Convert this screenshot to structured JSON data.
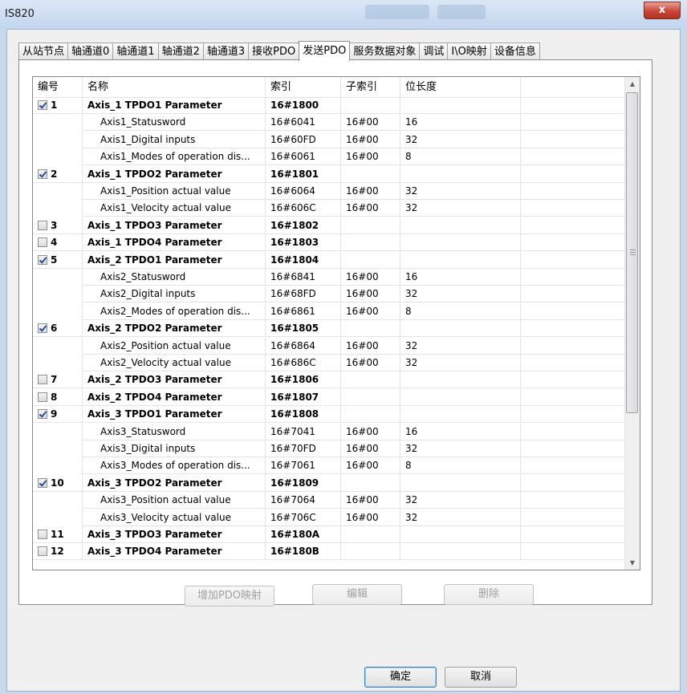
{
  "window": {
    "title": "IS820",
    "close_glyph": "x"
  },
  "tabs": [
    {
      "label": "从站节点"
    },
    {
      "label": "轴通道0"
    },
    {
      "label": "轴通道1"
    },
    {
      "label": "轴通道2"
    },
    {
      "label": "轴通道3"
    },
    {
      "label": "接收PDO"
    },
    {
      "label": "发送PDO",
      "active": true
    },
    {
      "label": "服务数据对象"
    },
    {
      "label": "调试"
    },
    {
      "label": "I\\O映射"
    },
    {
      "label": "设备信息"
    }
  ],
  "table": {
    "headers": [
      "编号",
      "名称",
      "索引",
      "子索引",
      "位长度"
    ],
    "rows": [
      {
        "type": "parent",
        "checked": true,
        "num": "1",
        "name": "Axis_1 TPDO1 Parameter",
        "index": "16#1800",
        "sub": "",
        "bits": ""
      },
      {
        "type": "child",
        "num": "",
        "name": "Axis1_Statusword",
        "index": "16#6041",
        "sub": "16#00",
        "bits": "16"
      },
      {
        "type": "child",
        "num": "",
        "name": "Axis1_Digital inputs",
        "index": "16#60FD",
        "sub": "16#00",
        "bits": "32"
      },
      {
        "type": "child",
        "num": "",
        "name": "Axis1_Modes of operation dis...",
        "index": "16#6061",
        "sub": "16#00",
        "bits": "8"
      },
      {
        "type": "parent",
        "checked": true,
        "num": "2",
        "name": "Axis_1 TPDO2 Parameter",
        "index": "16#1801",
        "sub": "",
        "bits": ""
      },
      {
        "type": "child",
        "num": "",
        "name": "Axis1_Position actual value",
        "index": "16#6064",
        "sub": "16#00",
        "bits": "32"
      },
      {
        "type": "child",
        "num": "",
        "name": "Axis1_Velocity actual value",
        "index": "16#606C",
        "sub": "16#00",
        "bits": "32"
      },
      {
        "type": "parent",
        "checked": false,
        "num": "3",
        "name": "Axis_1 TPDO3 Parameter",
        "index": "16#1802",
        "sub": "",
        "bits": ""
      },
      {
        "type": "parent",
        "checked": false,
        "num": "4",
        "name": "Axis_1 TPDO4 Parameter",
        "index": "16#1803",
        "sub": "",
        "bits": ""
      },
      {
        "type": "parent",
        "checked": true,
        "num": "5",
        "name": "Axis_2 TPDO1 Parameter",
        "index": "16#1804",
        "sub": "",
        "bits": ""
      },
      {
        "type": "child",
        "num": "",
        "name": "Axis2_Statusword",
        "index": "16#6841",
        "sub": "16#00",
        "bits": "16"
      },
      {
        "type": "child",
        "num": "",
        "name": "Axis2_Digital inputs",
        "index": "16#68FD",
        "sub": "16#00",
        "bits": "32"
      },
      {
        "type": "child",
        "num": "",
        "name": "Axis2_Modes of operation dis...",
        "index": "16#6861",
        "sub": "16#00",
        "bits": "8"
      },
      {
        "type": "parent",
        "checked": true,
        "num": "6",
        "name": "Axis_2 TPDO2 Parameter",
        "index": "16#1805",
        "sub": "",
        "bits": ""
      },
      {
        "type": "child",
        "num": "",
        "name": "Axis2_Position actual value",
        "index": "16#6864",
        "sub": "16#00",
        "bits": "32"
      },
      {
        "type": "child",
        "num": "",
        "name": "Axis2_Velocity actual value",
        "index": "16#686C",
        "sub": "16#00",
        "bits": "32"
      },
      {
        "type": "parent",
        "checked": false,
        "num": "7",
        "name": "Axis_2 TPDO3 Parameter",
        "index": "16#1806",
        "sub": "",
        "bits": ""
      },
      {
        "type": "parent",
        "checked": false,
        "num": "8",
        "name": "Axis_2 TPDO4 Parameter",
        "index": "16#1807",
        "sub": "",
        "bits": ""
      },
      {
        "type": "parent",
        "checked": true,
        "num": "9",
        "name": "Axis_3 TPDO1 Parameter",
        "index": "16#1808",
        "sub": "",
        "bits": ""
      },
      {
        "type": "child",
        "num": "",
        "name": "Axis3_Statusword",
        "index": "16#7041",
        "sub": "16#00",
        "bits": "16"
      },
      {
        "type": "child",
        "num": "",
        "name": "Axis3_Digital inputs",
        "index": "16#70FD",
        "sub": "16#00",
        "bits": "32"
      },
      {
        "type": "child",
        "num": "",
        "name": "Axis3_Modes of operation dis...",
        "index": "16#7061",
        "sub": "16#00",
        "bits": "8"
      },
      {
        "type": "parent",
        "checked": true,
        "num": "10",
        "name": "Axis_3 TPDO2 Parameter",
        "index": "16#1809",
        "sub": "",
        "bits": ""
      },
      {
        "type": "child",
        "num": "",
        "name": "Axis3_Position actual value",
        "index": "16#7064",
        "sub": "16#00",
        "bits": "32"
      },
      {
        "type": "child",
        "num": "",
        "name": "Axis3_Velocity actual value",
        "index": "16#706C",
        "sub": "16#00",
        "bits": "32"
      },
      {
        "type": "parent",
        "checked": false,
        "num": "11",
        "name": "Axis_3 TPDO3 Parameter",
        "index": "16#180A",
        "sub": "",
        "bits": ""
      },
      {
        "type": "parent",
        "checked": false,
        "num": "12",
        "name": "Axis_3 TPDO4 Parameter",
        "index": "16#180B",
        "sub": "",
        "bits": ""
      }
    ]
  },
  "actions": {
    "add_label": "增加PDO映射",
    "edit_label": "编辑",
    "delete_label": "删除"
  },
  "dialog": {
    "ok_label": "确定",
    "cancel_label": "取消"
  },
  "scrollbar": {
    "up_glyph": "▲",
    "down_glyph": "▼"
  }
}
